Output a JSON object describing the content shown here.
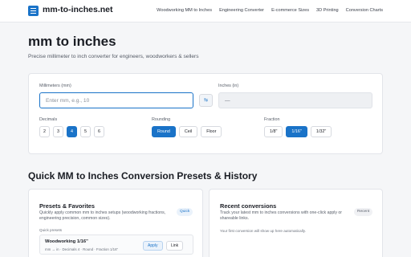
{
  "header": {
    "brand": "mm-to-inches.net",
    "nav": [
      "Woodworking MM to Inches",
      "Engineering Converter",
      "E-commerce Sizes",
      "3D Printing",
      "Conversion Charts"
    ]
  },
  "hero": {
    "title": "mm to inches",
    "subtitle": "Precise millimeter to inch converter for engineers, woodworkers & sellers"
  },
  "converter": {
    "mm_label": "Millimeters (mm)",
    "mm_placeholder": "Enter mm, e.g., 10",
    "mm_value": "",
    "swap_icon": "⇆",
    "in_label": "Inches (in)",
    "in_value": "—",
    "decimals_label": "Decimals",
    "decimals": [
      "2",
      "3",
      "4",
      "5",
      "6"
    ],
    "decimals_selected": "4",
    "rounding_label": "Rounding",
    "rounding": [
      "Round",
      "Ceil",
      "Floor"
    ],
    "rounding_selected": "Round",
    "fraction_label": "Fraction",
    "fraction": [
      "1/8\"",
      "1/16\"",
      "1/32\""
    ],
    "fraction_selected": "1/16\""
  },
  "section_title": "Quick MM to Inches Conversion Presets & History",
  "presets": {
    "title": "Presets & Favorites",
    "desc": "Quickly apply common mm to inches setups (woodworking fractions, engineering precision, common sizes).",
    "badge": "Quick",
    "list_label": "Quick presets",
    "items": [
      {
        "name": "Woodworking 1/16\"",
        "desc": "mm → in · Decimals 4 · Round · Fraction 1/16\"",
        "apply": "Apply",
        "link": "Link"
      }
    ]
  },
  "recent": {
    "title": "Recent conversions",
    "desc": "Track your latest mm to inches conversions with one-click apply or shareable links.",
    "badge": "Recent",
    "empty": "Your first conversion will show up here automatically."
  },
  "colors": {
    "accent": "#1a73c8",
    "background": "#f5f6f8"
  }
}
